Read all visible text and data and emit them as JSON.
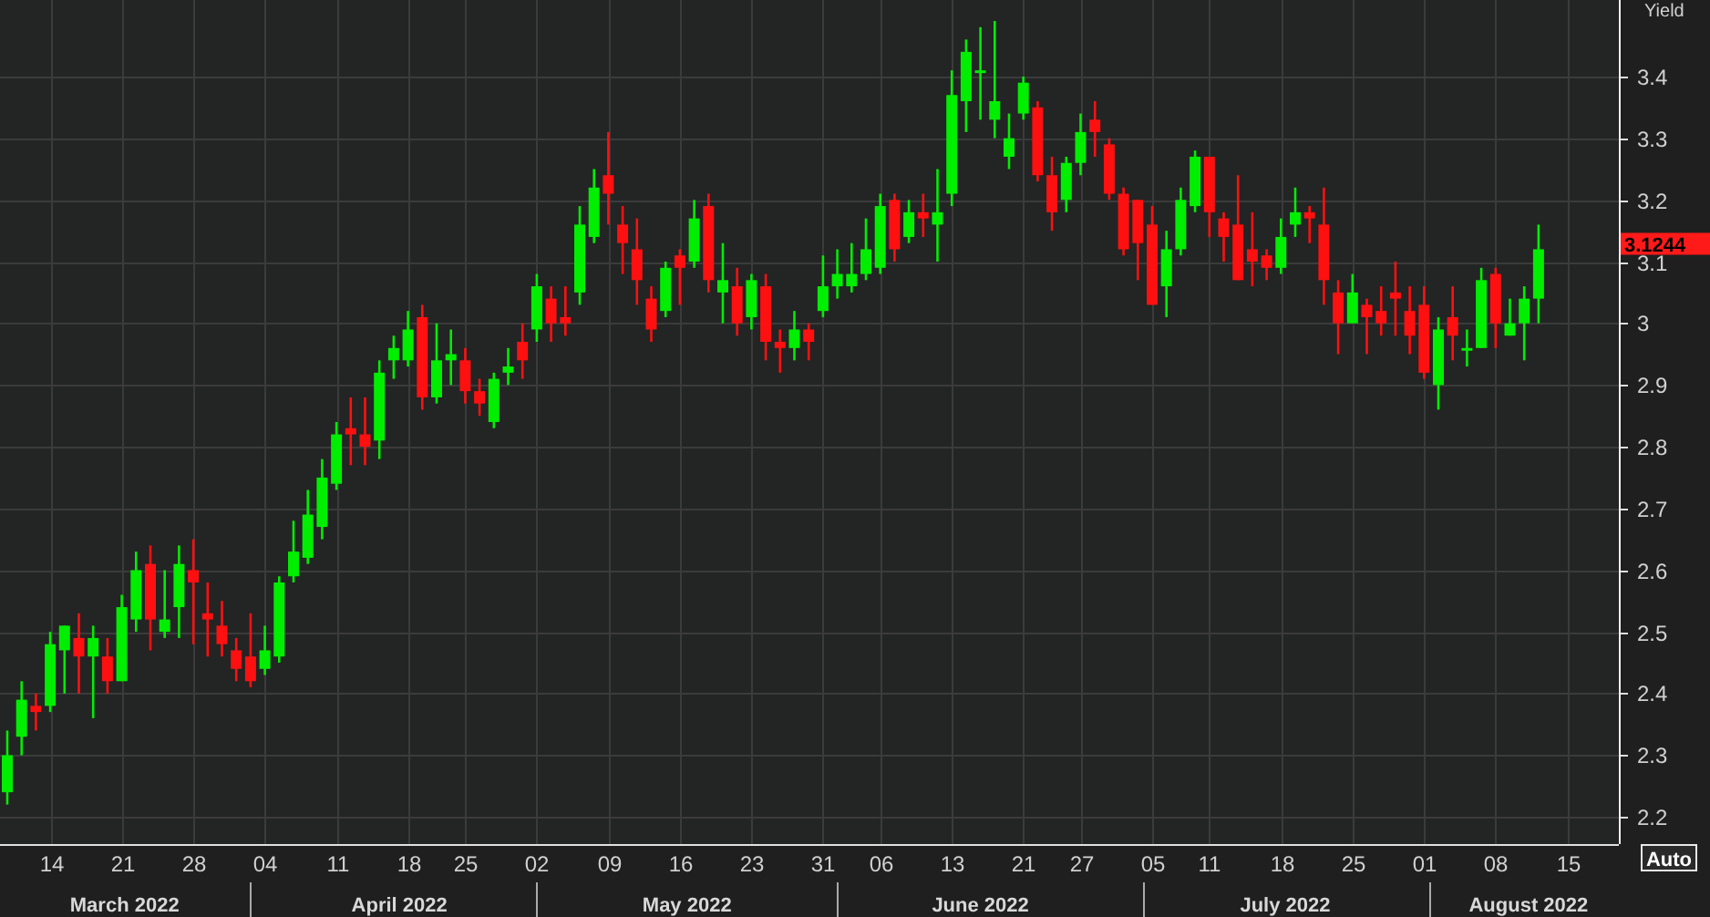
{
  "chart": {
    "chart_data": {
      "type": "candlestick",
      "ylabel": "Yield",
      "categories": [
        null,
        null,
        null,
        "14",
        null,
        null,
        null,
        null,
        "21",
        null,
        null,
        null,
        null,
        "28",
        null,
        null,
        null,
        null,
        "04",
        null,
        null,
        null,
        null,
        "11",
        null,
        null,
        null,
        null,
        "18",
        null,
        null,
        null,
        "25",
        null,
        null,
        null,
        null,
        "02",
        null,
        null,
        null,
        null,
        "09",
        null,
        null,
        null,
        null,
        "16",
        null,
        null,
        null,
        null,
        "23",
        null,
        null,
        null,
        null,
        "31",
        null,
        null,
        null,
        "06",
        null,
        null,
        null,
        null,
        "13",
        null,
        null,
        null,
        null,
        "21",
        null,
        null,
        null,
        "27",
        null,
        null,
        null,
        null,
        "05",
        null,
        null,
        null,
        "11",
        null,
        null,
        null,
        null,
        "18",
        null,
        null,
        null,
        null,
        "25",
        null,
        null,
        null,
        null,
        "01",
        null,
        null,
        null,
        null,
        "08",
        null,
        null,
        null,
        null,
        "15"
      ],
      "ohlc": [
        [
          2.24,
          2.34,
          2.22,
          2.3
        ],
        [
          2.33,
          2.42,
          2.3,
          2.39
        ],
        [
          2.38,
          2.4,
          2.34,
          2.37
        ],
        [
          2.38,
          2.5,
          2.37,
          2.48
        ],
        [
          2.47,
          2.51,
          2.4,
          2.51
        ],
        [
          2.49,
          2.53,
          2.4,
          2.46
        ],
        [
          2.46,
          2.51,
          2.36,
          2.49
        ],
        [
          2.46,
          2.49,
          2.4,
          2.42
        ],
        [
          2.42,
          2.56,
          2.42,
          2.54
        ],
        [
          2.52,
          2.63,
          2.5,
          2.6
        ],
        [
          2.61,
          2.64,
          2.47,
          2.52
        ],
        [
          2.5,
          2.6,
          2.49,
          2.52
        ],
        [
          2.54,
          2.64,
          2.49,
          2.61
        ],
        [
          2.6,
          2.65,
          2.48,
          2.58
        ],
        [
          2.53,
          2.58,
          2.46,
          2.52
        ],
        [
          2.51,
          2.55,
          2.46,
          2.48
        ],
        [
          2.47,
          2.49,
          2.42,
          2.44
        ],
        [
          2.46,
          2.53,
          2.41,
          2.42
        ],
        [
          2.44,
          2.51,
          2.43,
          2.47
        ],
        [
          2.46,
          2.59,
          2.45,
          2.58
        ],
        [
          2.59,
          2.68,
          2.58,
          2.63
        ],
        [
          2.62,
          2.73,
          2.61,
          2.69
        ],
        [
          2.67,
          2.78,
          2.65,
          2.75
        ],
        [
          2.74,
          2.84,
          2.73,
          2.82
        ],
        [
          2.83,
          2.88,
          2.77,
          2.82
        ],
        [
          2.82,
          2.88,
          2.77,
          2.8
        ],
        [
          2.81,
          2.94,
          2.78,
          2.92
        ],
        [
          2.94,
          2.98,
          2.91,
          2.96
        ],
        [
          2.94,
          3.02,
          2.93,
          2.99
        ],
        [
          3.01,
          3.03,
          2.86,
          2.88
        ],
        [
          2.88,
          3.0,
          2.87,
          2.94
        ],
        [
          2.94,
          2.99,
          2.9,
          2.95
        ],
        [
          2.94,
          2.96,
          2.87,
          2.89
        ],
        [
          2.89,
          2.91,
          2.85,
          2.87
        ],
        [
          2.84,
          2.92,
          2.83,
          2.91
        ],
        [
          2.92,
          2.96,
          2.9,
          2.93
        ],
        [
          2.97,
          3.0,
          2.91,
          2.94
        ],
        [
          2.99,
          3.08,
          2.97,
          3.06
        ],
        [
          3.04,
          3.06,
          2.97,
          3.0
        ],
        [
          3.01,
          3.06,
          2.98,
          3.0
        ],
        [
          3.05,
          3.19,
          3.03,
          3.16
        ],
        [
          3.14,
          3.25,
          3.13,
          3.22
        ],
        [
          3.24,
          3.31,
          3.16,
          3.21
        ],
        [
          3.16,
          3.19,
          3.08,
          3.13
        ],
        [
          3.12,
          3.17,
          3.03,
          3.07
        ],
        [
          3.04,
          3.06,
          2.97,
          2.99
        ],
        [
          3.02,
          3.1,
          3.01,
          3.09
        ],
        [
          3.11,
          3.12,
          3.03,
          3.09
        ],
        [
          3.1,
          3.2,
          3.09,
          3.17
        ],
        [
          3.19,
          3.21,
          3.05,
          3.07
        ],
        [
          3.05,
          3.13,
          3.0,
          3.07
        ],
        [
          3.06,
          3.09,
          2.98,
          3.0
        ],
        [
          3.01,
          3.08,
          2.99,
          3.07
        ],
        [
          3.06,
          3.08,
          2.94,
          2.97
        ],
        [
          2.97,
          2.99,
          2.92,
          2.96
        ],
        [
          2.96,
          3.02,
          2.94,
          2.99
        ],
        [
          2.99,
          3.0,
          2.94,
          2.97
        ],
        [
          3.02,
          3.11,
          3.01,
          3.06
        ],
        [
          3.06,
          3.12,
          3.04,
          3.08
        ],
        [
          3.06,
          3.13,
          3.05,
          3.08
        ],
        [
          3.08,
          3.17,
          3.07,
          3.12
        ],
        [
          3.09,
          3.21,
          3.08,
          3.19
        ],
        [
          3.2,
          3.21,
          3.1,
          3.12
        ],
        [
          3.14,
          3.2,
          3.13,
          3.18
        ],
        [
          3.18,
          3.21,
          3.14,
          3.17
        ],
        [
          3.16,
          3.25,
          3.1,
          3.18
        ],
        [
          3.21,
          3.41,
          3.19,
          3.37
        ],
        [
          3.36,
          3.46,
          3.31,
          3.44
        ],
        [
          3.41,
          3.48,
          3.33,
          3.41
        ],
        [
          3.33,
          3.49,
          3.3,
          3.36
        ],
        [
          3.27,
          3.34,
          3.25,
          3.3
        ],
        [
          3.34,
          3.4,
          3.33,
          3.39
        ],
        [
          3.35,
          3.36,
          3.23,
          3.24
        ],
        [
          3.24,
          3.27,
          3.15,
          3.18
        ],
        [
          3.2,
          3.27,
          3.18,
          3.26
        ],
        [
          3.26,
          3.34,
          3.24,
          3.31
        ],
        [
          3.33,
          3.36,
          3.27,
          3.31
        ],
        [
          3.29,
          3.3,
          3.2,
          3.21
        ],
        [
          3.21,
          3.22,
          3.11,
          3.12
        ],
        [
          3.2,
          3.2,
          3.07,
          3.13
        ],
        [
          3.16,
          3.19,
          3.03,
          3.03
        ],
        [
          3.06,
          3.15,
          3.01,
          3.12
        ],
        [
          3.12,
          3.22,
          3.11,
          3.2
        ],
        [
          3.19,
          3.28,
          3.18,
          3.27
        ],
        [
          3.27,
          3.27,
          3.14,
          3.18
        ],
        [
          3.17,
          3.18,
          3.1,
          3.14
        ],
        [
          3.16,
          3.24,
          3.07,
          3.07
        ],
        [
          3.12,
          3.18,
          3.06,
          3.1
        ],
        [
          3.11,
          3.12,
          3.07,
          3.09
        ],
        [
          3.09,
          3.17,
          3.08,
          3.14
        ],
        [
          3.16,
          3.22,
          3.14,
          3.18
        ],
        [
          3.18,
          3.19,
          3.13,
          3.17
        ],
        [
          3.16,
          3.22,
          3.03,
          3.07
        ],
        [
          3.05,
          3.07,
          2.95,
          3.0
        ],
        [
          3.0,
          3.08,
          3.0,
          3.05
        ],
        [
          3.03,
          3.04,
          2.95,
          3.01
        ],
        [
          3.02,
          3.06,
          2.98,
          3.0
        ],
        [
          3.05,
          3.1,
          2.98,
          3.04
        ],
        [
          3.02,
          3.06,
          2.95,
          2.98
        ],
        [
          3.03,
          3.06,
          2.91,
          2.92
        ],
        [
          2.9,
          3.01,
          2.86,
          2.99
        ],
        [
          3.01,
          3.06,
          2.94,
          2.98
        ],
        [
          2.96,
          2.99,
          2.93,
          2.96
        ],
        [
          2.96,
          3.09,
          2.96,
          3.07
        ],
        [
          3.08,
          3.09,
          2.96,
          3.0
        ],
        [
          2.98,
          3.04,
          2.98,
          3.0
        ],
        [
          3.0,
          3.06,
          2.94,
          3.04
        ],
        [
          3.04,
          3.16,
          3.0,
          3.12
        ],
        null,
        null
      ],
      "ylim": [
        2.156,
        3.524
      ],
      "grid": true,
      "yticks": [
        2.2,
        2.3,
        2.4,
        2.5,
        2.6,
        2.7,
        2.8,
        2.9,
        3,
        3.1,
        3.2,
        3.3,
        3.4
      ]
    },
    "last_price_tag": "3.1244",
    "months": [
      "March 2022",
      "April 2022",
      "May 2022",
      "June 2022",
      "July 2022",
      "August 2022"
    ],
    "scale_button": {
      "label": "Auto"
    }
  }
}
